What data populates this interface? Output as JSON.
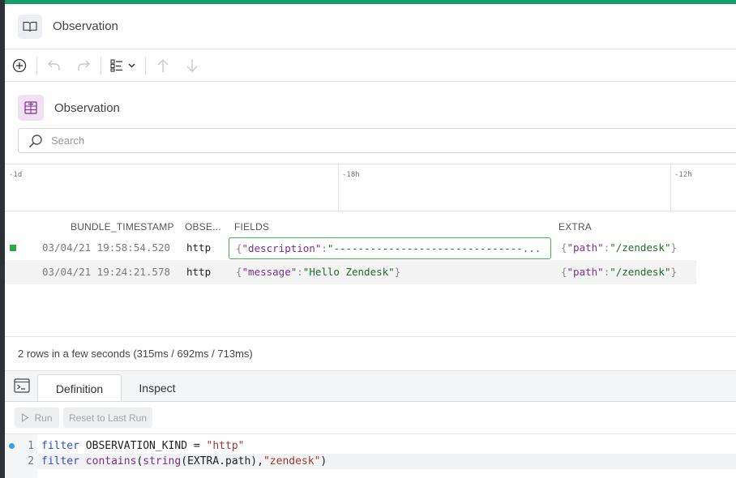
{
  "header": {
    "title": "Observation"
  },
  "dataset": {
    "title": "Observation",
    "search_placeholder": "Search"
  },
  "timeline": {
    "ticks": [
      "-1d",
      "-18h",
      "-12h"
    ]
  },
  "grid": {
    "columns": [
      "BUNDLE_TIMESTAMP",
      "OBSE...",
      "FIELDS",
      "EXTRA"
    ],
    "rows": [
      {
        "timestamp": "03/04/21 19:58:54.520",
        "kind": "http",
        "fields_key": "\"description\"",
        "fields_value": "\"-------------------------------...",
        "extra_key": "\"path\"",
        "extra_value": "\"/zendesk\""
      },
      {
        "timestamp": "03/04/21 19:24:21.578",
        "kind": "http",
        "fields_key": "\"message\"",
        "fields_value": "\"Hello Zendesk\"",
        "extra_key": "\"path\"",
        "extra_value": "\"/zendesk\""
      }
    ]
  },
  "status": {
    "text": "2 rows in a few seconds (315ms / 692ms / 713ms)"
  },
  "query": {
    "tabs": [
      "Definition",
      "Inspect"
    ],
    "run_label": "Run",
    "reset_label": "Reset to Last Run",
    "lines": [
      {
        "num": "1",
        "kw": "filter",
        "rest": " OBSERVATION_KIND = ",
        "str": "\"http\""
      },
      {
        "num": "2",
        "kw": "filter",
        "fn1": "contains",
        "fn2": "string",
        "args": "(EXTRA.path),",
        "str": "\"zendesk\""
      }
    ]
  },
  "colors": {
    "accent": "#14a06a",
    "selection": "#3fb64a"
  }
}
